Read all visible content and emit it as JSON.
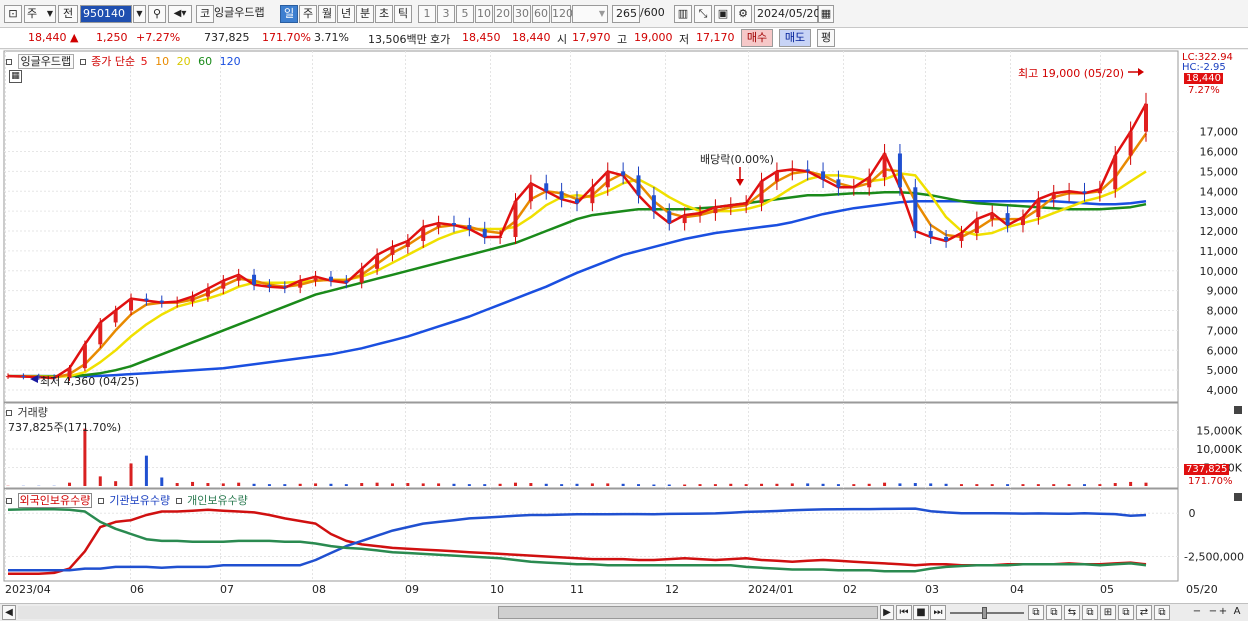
{
  "toolbar": {
    "type_label": "주",
    "prev_label": "전",
    "code": "950140",
    "name_icon": "코",
    "stock_name": "잉글우드랩",
    "periods": [
      "일",
      "주",
      "월",
      "년",
      "분",
      "초",
      "틱"
    ],
    "active_period": "일",
    "intervals": [
      "1",
      "3",
      "5",
      "10",
      "20",
      "30",
      "60",
      "120"
    ],
    "count": "265",
    "count_max": "/600",
    "date": "2024/05/20"
  },
  "info": {
    "price": "18,440",
    "arrow": "▲",
    "change": "1,250",
    "change_pct": "+7.27%",
    "volume": "737,825",
    "volume_ratio": "171.70%",
    "turnover": "3.71%",
    "amount": "13,506백만",
    "quote_label": "호가",
    "ask": "18,450",
    "bid": "18,440",
    "open_label": "시",
    "open": "17,970",
    "high_label": "고",
    "high": "19,000",
    "low_label": "저",
    "low": "17,170",
    "buy_label": "매수",
    "sell_label": "매도",
    "eval_label": "평"
  },
  "price_panel": {
    "stock_label": "잉글우드랩",
    "ma_prefix": "종가 단순",
    "ma_periods": [
      "5",
      "10",
      "20",
      "60",
      "120"
    ],
    "ma_colors": [
      "#e01010",
      "#e88a00",
      "#f0e000",
      "#1a8a1a",
      "#1a4fe0"
    ],
    "high_annotation": "최고 19,000 (05/20)",
    "low_annotation": "최저 4,360 (04/25)",
    "dividend_label": "배당락(0.00%)",
    "lc_label": "LC:322.94",
    "hc_label": "HC:-2.95",
    "current_price": "18,440",
    "current_pct": "7.27%"
  },
  "volume_panel": {
    "title": "거래량",
    "value": "737,825주(171.70%)",
    "current": "737,825",
    "current_pct": "171.70%"
  },
  "holder_panel": {
    "foreign": "외국인보유수량",
    "institution": "기관보유수량",
    "individual": "개인보유수량"
  },
  "x_labels": [
    "2023/04",
    "06",
    "07",
    "08",
    "09",
    "10",
    "11",
    "12",
    "2024/01",
    "02",
    "03",
    "04",
    "05",
    "05/20"
  ],
  "chart_data": [
    {
      "type": "line",
      "title": "",
      "y_ticks": [
        "17,000",
        "16,000",
        "15,000",
        "14,000",
        "13,000",
        "12,000",
        "11,000",
        "10,000",
        "9,000",
        "8,000",
        "7,000",
        "6,000",
        "5,000",
        "4,000"
      ],
      "ylim": [
        3600,
        20100
      ],
      "x_ticks": [
        "2023/04",
        "06",
        "07",
        "08",
        "09",
        "10",
        "11",
        "12",
        "2024/01",
        "02",
        "03",
        "04",
        "05"
      ],
      "series": [
        {
          "name": "5",
          "color": "#e01010",
          "values": [
            4700,
            4680,
            4650,
            4600,
            5100,
            6300,
            7400,
            8000,
            8600,
            8500,
            8400,
            8450,
            8700,
            9100,
            9500,
            9800,
            9300,
            9200,
            9150,
            9500,
            9700,
            9500,
            9400,
            10100,
            10800,
            11200,
            11500,
            12200,
            12400,
            12300,
            12100,
            11700,
            11700,
            13500,
            14400,
            14000,
            13600,
            13400,
            14200,
            15000,
            14800,
            13800,
            13000,
            12400,
            12800,
            12900,
            13200,
            13300,
            13400,
            14500,
            15000,
            15100,
            15000,
            14600,
            14200,
            14200,
            14700,
            15900,
            14200,
            12000,
            11700,
            11500,
            11900,
            12600,
            12900,
            12300,
            12700,
            13600,
            13900,
            14000,
            13900,
            14100,
            15800,
            17000,
            18400
          ]
        },
        {
          "name": "10",
          "color": "#e88a00",
          "values": [
            4700,
            4680,
            4660,
            4620,
            4800,
            5300,
            6100,
            7000,
            7800,
            8300,
            8400,
            8400,
            8550,
            8850,
            9250,
            9600,
            9500,
            9300,
            9200,
            9300,
            9500,
            9550,
            9500,
            9800,
            10350,
            10900,
            11300,
            11800,
            12200,
            12300,
            12200,
            12000,
            11900,
            12500,
            13600,
            14000,
            13900,
            13600,
            13800,
            14500,
            14900,
            14400,
            13500,
            12900,
            12700,
            12800,
            13000,
            13200,
            13300,
            13900,
            14500,
            14900,
            15000,
            14800,
            14400,
            14200,
            14400,
            15100,
            15000,
            13500,
            12300,
            11800,
            11700,
            12100,
            12600,
            12600,
            12600,
            13100,
            13700,
            13900,
            13900,
            14000,
            14700,
            15800,
            16900
          ]
        },
        {
          "name": "20",
          "color": "#f0e000",
          "values": [
            4700,
            4690,
            4680,
            4660,
            4700,
            4900,
            5400,
            6000,
            6700,
            7300,
            7800,
            8200,
            8400,
            8600,
            8850,
            9200,
            9400,
            9400,
            9400,
            9450,
            9500,
            9550,
            9550,
            9700,
            10000,
            10400,
            10800,
            11200,
            11600,
            11900,
            12100,
            12100,
            12100,
            12200,
            12700,
            13300,
            13700,
            13800,
            13700,
            14000,
            14400,
            14600,
            14200,
            13700,
            13300,
            13000,
            13000,
            13000,
            13100,
            13300,
            13700,
            14200,
            14600,
            14800,
            14800,
            14700,
            14500,
            14600,
            14900,
            14800,
            13800,
            12700,
            12000,
            11800,
            11900,
            12200,
            12400,
            12600,
            12900,
            13200,
            13500,
            13700,
            14000,
            14500,
            15000
          ]
        },
        {
          "name": "60",
          "color": "#1a8a1a",
          "values": [
            4700,
            4700,
            4700,
            4690,
            4700,
            4750,
            4850,
            5000,
            5200,
            5500,
            5800,
            6100,
            6400,
            6700,
            7000,
            7300,
            7600,
            7900,
            8200,
            8500,
            8800,
            9000,
            9200,
            9400,
            9600,
            9800,
            10000,
            10200,
            10400,
            10600,
            10800,
            11000,
            11200,
            11400,
            11700,
            12000,
            12300,
            12600,
            12800,
            12900,
            13000,
            13100,
            13100,
            13100,
            13100,
            13150,
            13200,
            13300,
            13400,
            13500,
            13600,
            13700,
            13800,
            13800,
            13850,
            13900,
            13900,
            13950,
            13950,
            13900,
            13800,
            13650,
            13500,
            13400,
            13350,
            13300,
            13250,
            13200,
            13150,
            13100,
            13100,
            13100,
            13150,
            13200,
            13350
          ]
        },
        {
          "name": "120",
          "color": "#1a4fe0",
          "values": [
            4700,
            4700,
            4700,
            4700,
            4700,
            4700,
            4710,
            4750,
            4800,
            4850,
            4900,
            4950,
            5000,
            5050,
            5100,
            5200,
            5300,
            5400,
            5500,
            5600,
            5700,
            5800,
            5950,
            6100,
            6300,
            6500,
            6700,
            6950,
            7200,
            7450,
            7700,
            8000,
            8300,
            8600,
            8900,
            9200,
            9550,
            9900,
            10200,
            10500,
            10800,
            11000,
            11200,
            11400,
            11600,
            11750,
            11900,
            12000,
            12100,
            12200,
            12300,
            12450,
            12650,
            12850,
            13000,
            13150,
            13250,
            13350,
            13450,
            13500,
            13500,
            13500,
            13500,
            13500,
            13500,
            13500,
            13500,
            13500,
            13500,
            13450,
            13400,
            13350,
            13350,
            13400,
            13500
          ]
        }
      ]
    },
    {
      "type": "bar",
      "title": "거래량",
      "y_ticks": [
        "15,000K",
        "10,000K",
        "5,000K"
      ],
      "ylim": [
        0,
        20000
      ],
      "values": [
        60,
        50,
        60,
        60,
        900,
        15500,
        2600,
        1300,
        6100,
        8200,
        2300,
        800,
        1100,
        800,
        700,
        900,
        600,
        500,
        500,
        600,
        700,
        600,
        500,
        800,
        900,
        700,
        800,
        700,
        700,
        600,
        500,
        500,
        600,
        900,
        800,
        600,
        500,
        600,
        700,
        700,
        600,
        500,
        400,
        400,
        400,
        500,
        500,
        600,
        500,
        600,
        600,
        700,
        700,
        600,
        500,
        500,
        600,
        900,
        700,
        800,
        700,
        600,
        500,
        500,
        500,
        500,
        500,
        500,
        500,
        500,
        500,
        500,
        800,
        1100,
        900
      ]
    },
    {
      "type": "line",
      "title": "",
      "y_ticks": [
        "0",
        "-2,500,000"
      ],
      "ylim": [
        -3800000,
        650000
      ],
      "series": [
        {
          "name": "외국인보유수량",
          "color": "#d01010",
          "values": [
            -3500000,
            -3500000,
            -3500000,
            -3450000,
            -3200000,
            -2200000,
            -800000,
            -500000,
            -400000,
            -100000,
            100000,
            100000,
            150000,
            200000,
            150000,
            100000,
            50000,
            -100000,
            -300000,
            -450000,
            -600000,
            -1200000,
            -1600000,
            -1800000,
            -1900000,
            -2000000,
            -2050000,
            -2100000,
            -2150000,
            -2200000,
            -2250000,
            -2300000,
            -2350000,
            -2400000,
            -2450000,
            -2500000,
            -2550000,
            -2600000,
            -2650000,
            -2650000,
            -2650000,
            -2700000,
            -2700000,
            -2650000,
            -2600000,
            -2650000,
            -2700000,
            -2650000,
            -2600000,
            -2700000,
            -2750000,
            -2800000,
            -2750000,
            -2700000,
            -2750000,
            -2800000,
            -2850000,
            -2900000,
            -2950000,
            -3000000,
            -2950000,
            -2950000,
            -3000000,
            -3000000,
            -3000000,
            -2950000,
            -2950000,
            -2950000,
            -2950000,
            -2900000,
            -2950000,
            -2950000,
            -2900000,
            -2850000,
            -2950000
          ]
        },
        {
          "name": "기관보유수량",
          "color": "#2050d0",
          "values": [
            -3300000,
            -3300000,
            -3300000,
            -3300000,
            -3300000,
            -3200000,
            -3200000,
            -3100000,
            -3100000,
            -3100000,
            -3150000,
            -3100000,
            -3100000,
            -3100000,
            -3000000,
            -3000000,
            -3000000,
            -3000000,
            -3000000,
            -3000000,
            -2700000,
            -2300000,
            -1900000,
            -1600000,
            -1300000,
            -1000000,
            -800000,
            -600000,
            -500000,
            -400000,
            -300000,
            -250000,
            -200000,
            -150000,
            -100000,
            -100000,
            -80000,
            -60000,
            -60000,
            -60000,
            -50000,
            -50000,
            -60000,
            -40000,
            -30000,
            -20000,
            -10000,
            30000,
            80000,
            100000,
            130000,
            170000,
            200000,
            220000,
            230000,
            240000,
            240000,
            250000,
            260000,
            270000,
            120000,
            50000,
            0,
            0,
            0,
            -10000,
            -20000,
            -10000,
            -20000,
            -30000,
            0,
            -30000,
            -50000,
            -150000,
            -100000
          ]
        },
        {
          "name": "개인보유수량",
          "color": "#2a8a50",
          "values": [
            200000,
            220000,
            230000,
            230000,
            200000,
            100000,
            -500000,
            -900000,
            -1200000,
            -1500000,
            -1600000,
            -1600000,
            -1650000,
            -1650000,
            -1650000,
            -1600000,
            -1600000,
            -1600000,
            -1650000,
            -1650000,
            -1750000,
            -1900000,
            -2000000,
            -2050000,
            -2150000,
            -2250000,
            -2300000,
            -2350000,
            -2400000,
            -2450000,
            -2500000,
            -2550000,
            -2600000,
            -2700000,
            -2800000,
            -2850000,
            -2900000,
            -2950000,
            -2950000,
            -3000000,
            -3000000,
            -3000000,
            -3000000,
            -3000000,
            -3000000,
            -3000000,
            -3000000,
            -3000000,
            -3100000,
            -3150000,
            -3200000,
            -3250000,
            -3250000,
            -3250000,
            -3300000,
            -3300000,
            -3300000,
            -3350000,
            -3350000,
            -3350000,
            -3200000,
            -3100000,
            -3050000,
            -3000000,
            -3000000,
            -3000000,
            -2950000,
            -2950000,
            -2950000,
            -2950000,
            -2950000,
            -3000000,
            -2950000,
            -2900000,
            -3000000
          ]
        }
      ]
    }
  ]
}
